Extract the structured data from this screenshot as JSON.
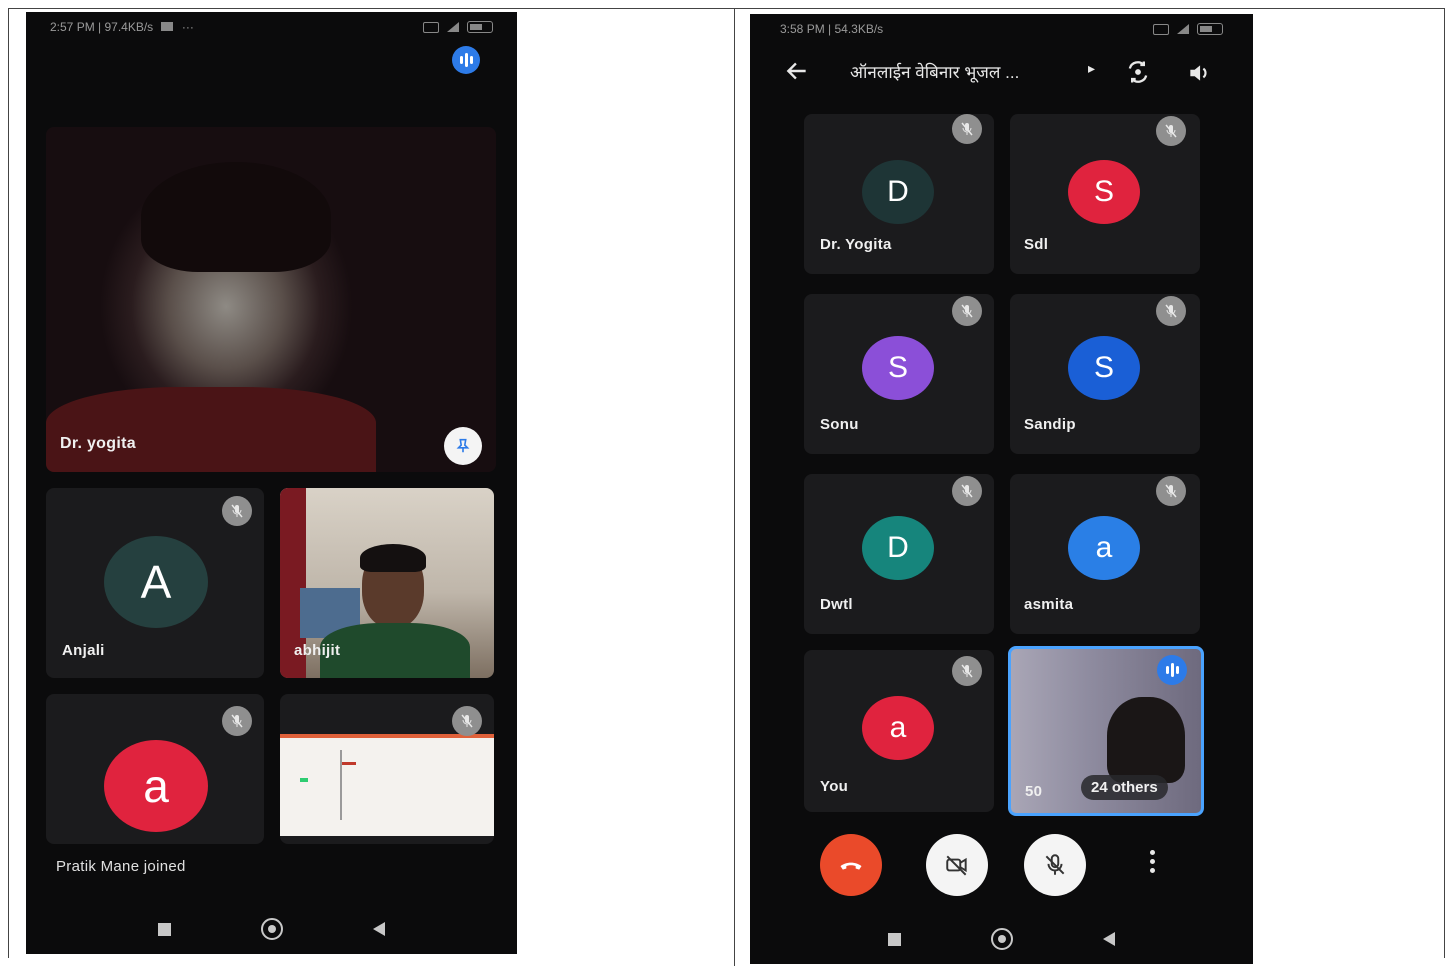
{
  "left_phone": {
    "status_bar": {
      "time_speed": "2:57 PM | 97.4KB/s",
      "extra": "···"
    },
    "speaking_indicator": "audio-wave-icon",
    "main_speaker": {
      "name": "Dr. yogita",
      "pin_icon": "pin-icon"
    },
    "tiles": [
      {
        "name": "Anjali",
        "initial": "A",
        "color": "#25403f",
        "muted": true
      },
      {
        "name": "abhijit",
        "type": "video",
        "muted": false
      },
      {
        "name": "",
        "initial": "a",
        "color": "#e0233e",
        "muted": true
      },
      {
        "name": "",
        "type": "screen-share",
        "muted": true
      }
    ],
    "toast": "Pratik Mane joined"
  },
  "right_phone": {
    "status_bar": {
      "time_speed": "3:58 PM | 54.3KB/s"
    },
    "header": {
      "title": "ऑनलाईन वेबिनार भूजल ...",
      "arrow": "▸"
    },
    "participants": [
      {
        "name": "Dr. Yogita",
        "initial": "D",
        "color": "#1e3536"
      },
      {
        "name": "Sdl",
        "initial": "S",
        "color": "#e0233e"
      },
      {
        "name": "Sonu",
        "initial": "S",
        "color": "#8b4fd8"
      },
      {
        "name": "Sandip",
        "initial": "S",
        "color": "#1a5fd6"
      },
      {
        "name": "Dwtl",
        "initial": "D",
        "color": "#16857c"
      },
      {
        "name": "asmita",
        "initial": "a",
        "color": "#2a7fe6"
      },
      {
        "name": "You",
        "initial": "a",
        "color": "#e0233e"
      }
    ],
    "others_tile": {
      "partial_label": "50",
      "others_label": "24 others"
    },
    "colors": {
      "accent_blue": "#4aa3ff",
      "end_call_red": "#ea4a2a"
    }
  }
}
